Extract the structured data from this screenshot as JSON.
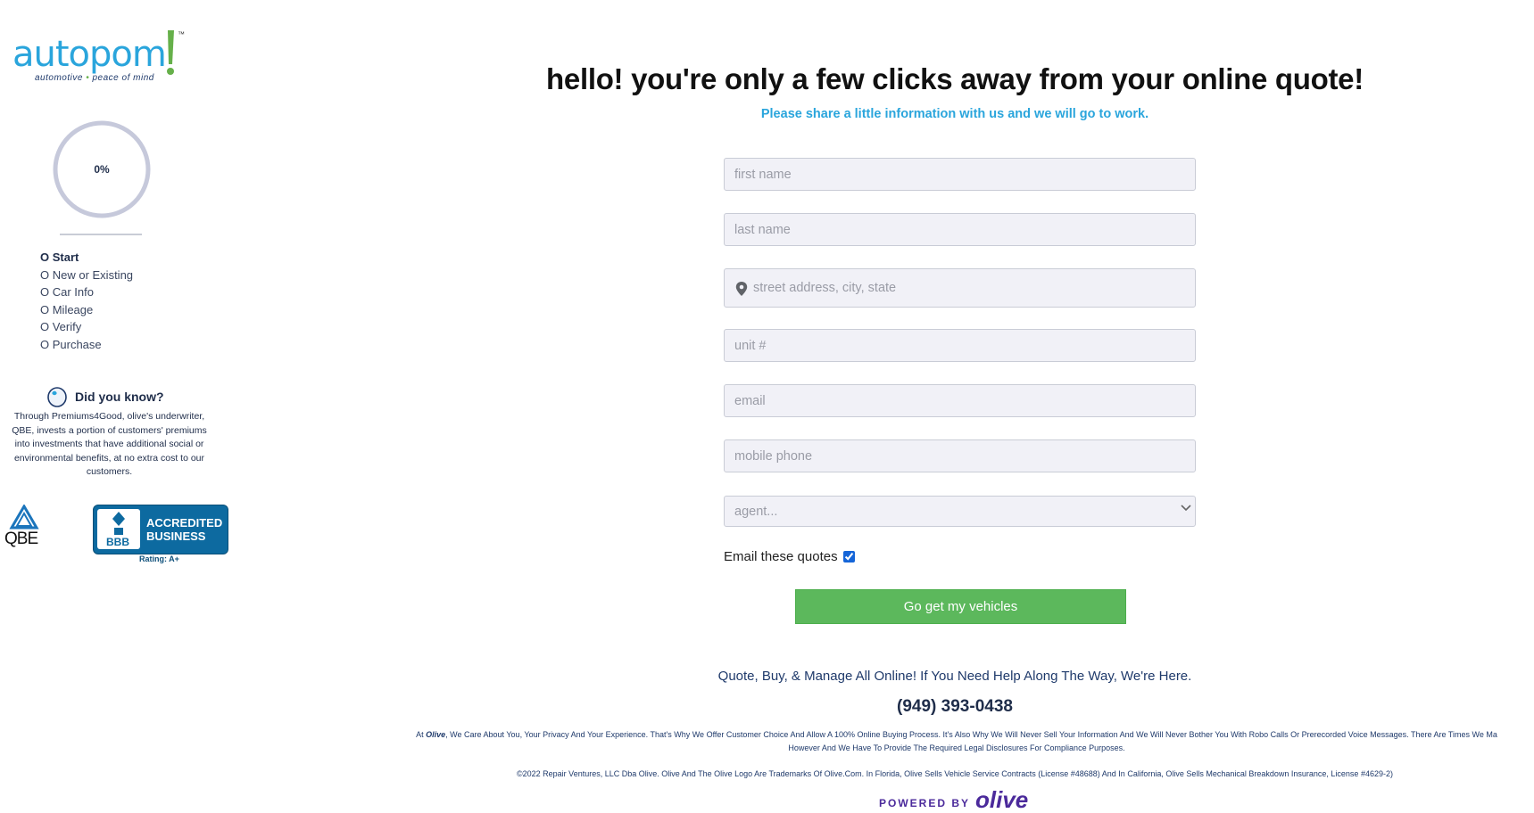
{
  "brand": {
    "logo_word": "autopom",
    "logo_tm": "™",
    "tagline_a": "automotive",
    "tagline_b": "peace of mind",
    "accent": "#2aa5dc",
    "logo_green": "#66b04a"
  },
  "progress": {
    "percent_label": "0%",
    "value": 0
  },
  "steps": [
    {
      "label": "O Start"
    },
    {
      "label": "O New or Existing"
    },
    {
      "label": "O Car Info"
    },
    {
      "label": "O Mileage"
    },
    {
      "label": "O Verify"
    },
    {
      "label": "O Purchase"
    }
  ],
  "did_you_know": {
    "title": "Did you know?",
    "line1": "Through Premiums4Good, olive's underwriter,",
    "line2": "QBE, invests a portion of customers' premiums",
    "line3": "into investments that have additional social or",
    "line4": "environmental benefits, at no extra cost to our",
    "line5": "customers."
  },
  "badges": {
    "qbe": "QBE",
    "bbb_mark": "BBB",
    "bbb_line1": "ACCREDITED",
    "bbb_line2": "BUSINESS",
    "bbb_rating": "Rating: A+"
  },
  "header": {
    "title": "hello! you're only a few clicks away from your online quote!",
    "subtitle": "Please share a little information with us and we will go to work."
  },
  "form": {
    "first_name_placeholder": "first name",
    "last_name_placeholder": "last name",
    "address_placeholder": "street address, city, state",
    "unit_placeholder": "unit #",
    "email_placeholder": "email",
    "phone_placeholder": "mobile phone",
    "agent_selected": "agent...",
    "email_quotes_label": "Email these quotes",
    "email_quotes_checked": true,
    "submit_label": "Go get my vehicles",
    "submit_color": "#5cb85c"
  },
  "footer": {
    "help_line": "Quote, Buy, & Manage All Online! If You Need Help Along The Way, We're Here.",
    "phone": "(949) 393-0438",
    "legal_prefix": "At ",
    "legal_brand": "Olive",
    "legal_line1": ", We Care About You, Your Privacy And Your Experience. That's Why We Offer Customer Choice And Allow A 100% Online Buying Process. It's Also Why We Will Never Sell Your Information And We Will Never Bother You With Robo Calls Or Prerecorded Voice Messages. There Are Times We Ma",
    "legal_line2": "However And We Have To Provide The Required Legal Disclosures For Compliance Purposes.",
    "copyright": "©2022 Repair Ventures, LLC Dba Olive. Olive And The Olive Logo Are Trademarks Of Olive.Com. In Florida, Olive Sells Vehicle Service Contracts (License #48688) And In California, Olive Sells Mechanical Breakdown Insurance, License #4629-2)",
    "powered_by": "POWERED BY",
    "powered_brand": "olive",
    "powered_color": "#4b2a9b"
  }
}
